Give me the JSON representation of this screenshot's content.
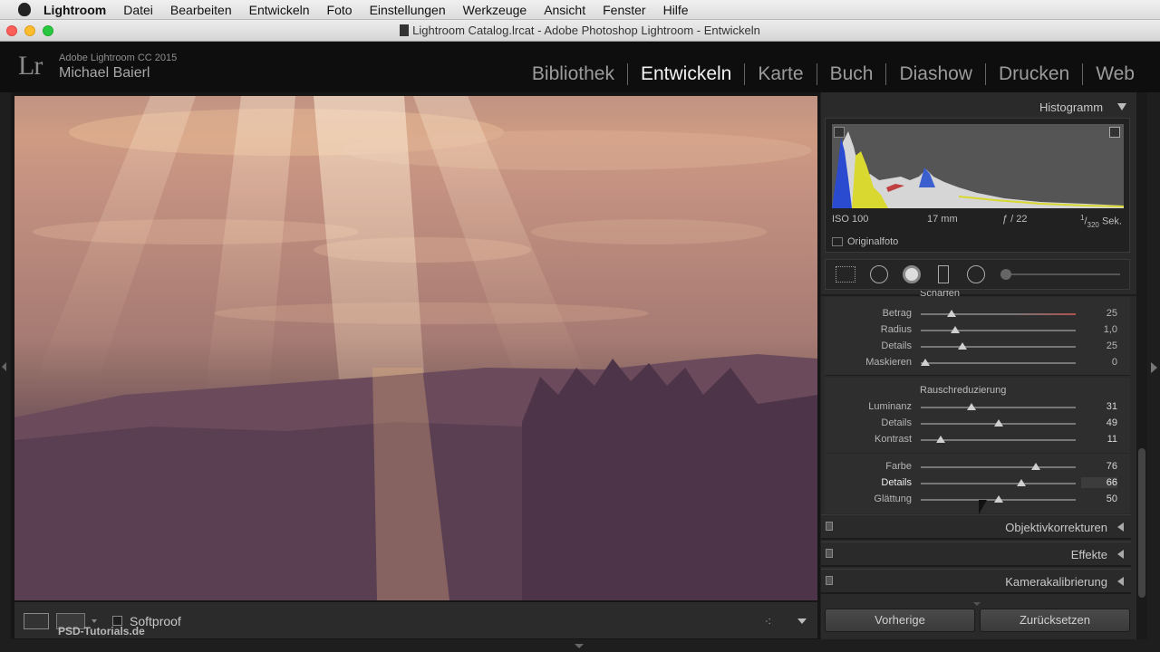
{
  "menubar": {
    "app_name": "Lightroom",
    "items": [
      "Datei",
      "Bearbeiten",
      "Entwickeln",
      "Foto",
      "Einstellungen",
      "Werkzeuge",
      "Ansicht",
      "Fenster",
      "Hilfe"
    ]
  },
  "window": {
    "title": "Lightroom Catalog.lrcat - Adobe Photoshop Lightroom - Entwickeln"
  },
  "identity": {
    "logo": "Lr",
    "product": "Adobe Lightroom CC 2015",
    "user": "Michael Baierl"
  },
  "modules": {
    "items": [
      "Bibliothek",
      "Entwickeln",
      "Karte",
      "Buch",
      "Diashow",
      "Drucken",
      "Web"
    ],
    "active": "Entwickeln"
  },
  "histogram": {
    "title": "Histogramm",
    "iso": "ISO 100",
    "focal": "17 mm",
    "aperture": "ƒ / 22",
    "shutter_num": "1",
    "shutter_den": "320",
    "shutter_unit": "Sek.",
    "original_label": "Originalfoto"
  },
  "sharpen": {
    "title": "Schärfen",
    "rows": [
      {
        "label": "Betrag",
        "value": "25",
        "pos": 0.2
      },
      {
        "label": "Radius",
        "value": "1,0",
        "pos": 0.22
      },
      {
        "label": "Details",
        "value": "25",
        "pos": 0.27
      },
      {
        "label": "Maskieren",
        "value": "0",
        "pos": 0.03
      }
    ]
  },
  "noise": {
    "title": "Rauschreduzierung",
    "luminance_rows": [
      {
        "label": "Luminanz",
        "value": "31",
        "pos": 0.33
      },
      {
        "label": "Details",
        "value": "49",
        "pos": 0.5
      },
      {
        "label": "Kontrast",
        "value": "11",
        "pos": 0.13
      }
    ],
    "color_rows": [
      {
        "label": "Farbe",
        "value": "76",
        "pos": 0.74
      },
      {
        "label": "Details",
        "value": "66",
        "pos": 0.65
      },
      {
        "label": "Glättung",
        "value": "50",
        "pos": 0.5
      }
    ]
  },
  "collapsed_panels": [
    "Objektivkorrekturen",
    "Effekte",
    "Kamerakalibrierung"
  ],
  "buttons": {
    "previous": "Vorherige",
    "reset": "Zurücksetzen"
  },
  "toolbar": {
    "softproof": "Softproof"
  },
  "watermark": "PSD-Tutorials.de"
}
